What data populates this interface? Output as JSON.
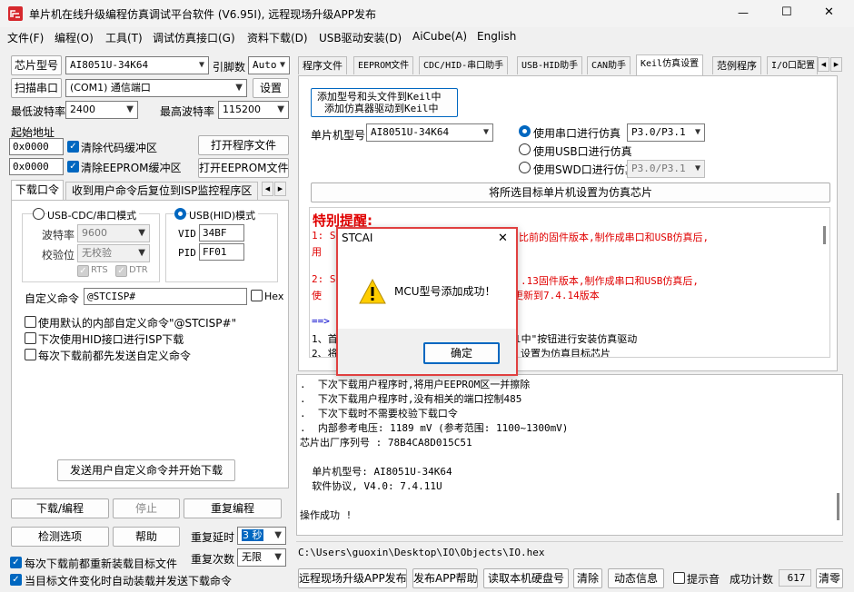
{
  "window": {
    "title": "单片机在线升级编程仿真调试平台软件 (V6.95I), 远程现场升级APP发布",
    "minimize": "—",
    "maximize": "☐",
    "close": "✕"
  },
  "menu": [
    "文件(F)",
    "编程(O)",
    "工具(T)",
    "调试仿真接口(G)",
    "资料下载(D)",
    "USB驱动安装(D)",
    "AiCube(A)",
    "English"
  ],
  "left": {
    "chip_btn": "芯片型号",
    "chip_value": "AI8051U-34K64",
    "pins_label": "引脚数",
    "pins_value": "Auto",
    "scan_btn": "扫描串口",
    "port_value": "(COM1) 通信端口",
    "settings_btn": "设置",
    "min_baud_label": "最低波特率",
    "min_baud": "2400",
    "max_baud_label": "最高波特率",
    "max_baud": "115200",
    "start_addr_label": "起始地址",
    "addr1": "0x0000",
    "clear_code": "清除代码缓冲区",
    "open_prog": "打开程序文件",
    "addr2": "0x0000",
    "clear_eeprom": "清除EEPROM缓冲区",
    "open_eeprom": "打开EEPROM文件",
    "tab_download": "下载口令",
    "tab_reset": "收到用户命令后复位到ISP监控程序区",
    "usb_cdc_mode": "USB-CDC/串口模式",
    "usb_hid_mode": "USB(HID)模式",
    "baud_label": "波特率",
    "baud_value": "9600",
    "parity_label": "校验位",
    "parity_value": "无校验",
    "rts": "RTS",
    "dtr": "DTR",
    "vid_label": "VID",
    "vid": "34BF",
    "pid_label": "PID",
    "pid": "FF01",
    "custom_cmd_label": "自定义命令",
    "custom_cmd": "@STCISP#",
    "hex": "Hex",
    "opt1": "使用默认的内部自定义命令\"@STCISP#\"",
    "opt2": "下次使用HID接口进行ISP下载",
    "opt3": "每次下载前都先发送自定义命令",
    "send_btn": "发送用户自定义命令并开始下载",
    "download_btn": "下载/编程",
    "stop_btn": "停止",
    "reprog_btn": "重复编程",
    "detect_btn": "检测选项",
    "help_btn": "帮助",
    "repeat_delay_label": "重复延时",
    "repeat_delay": "3 秒",
    "repeat_count_label": "重复次数",
    "repeat_count": "无限",
    "reload_each": "每次下载前都重新装载目标文件",
    "auto_load": "当目标文件变化时自动装载并发送下载命令"
  },
  "right": {
    "tabs": [
      "程序文件",
      "EEPROM文件",
      "CDC/HID-串口助手",
      "USB-HID助手",
      "CAN助手",
      "Keil仿真设置",
      "范例程序",
      "I/O口配置"
    ],
    "add_btn_line1": "添加型号和头文件到Keil中",
    "add_btn_line2": "添加仿真器驱动到Keil中",
    "mcu_label": "单片机型号",
    "mcu_value": "AI8051U-34K64",
    "serial_sim": "使用串口进行仿真",
    "serial_pins": "P3.0/P3.1",
    "usb_sim": "使用USB口进行仿真",
    "swd_sim": "使用SWD口进行仿真",
    "swd_pins": "P3.0/P3.1",
    "set_btn": "将所选目标单片机设置为仿真芯片",
    "notice_title": "特别提醒:",
    "notice_lines": [
      "1: S",
      "    用",
      "2: S",
      "    使",
      "   ==>",
      "1、首",
      "2、将"
    ],
    "notice_tails": [
      "比前的固件版本,制作成串口和USB仿真后,",
      "",
      ".13固件版本,制作成串口和USB仿真后,",
      "更新到7.4.14版本",
      "",
      "l中\"按钮进行安装仿真驱动",
      "设置为仿真目标芯片"
    ],
    "log": [
      ".  下次下载用户程序时,将用户EEPROM区一并擦除",
      ".  下次下载用户程序时,没有相关的端口控制485",
      ".  下次下载时不需要校验下载口令",
      ".  内部参考电压: 1189 mV (参考范围: 1100~1300mV)",
      "芯片出厂序列号 : 78B4CA8D015C51",
      "",
      "  单片机型号: AI8051U-34K64",
      "  软件协议, V4.0: 7.4.11U",
      "",
      "操作成功 !"
    ],
    "path": "C:\\Users\\guoxin\\Desktop\\IO\\Objects\\IO.hex",
    "publish_btn": "远程现场升级APP发布",
    "help_btn": "发布APP帮助",
    "read_disk_btn": "读取本机硬盘号",
    "clear_btn": "清除",
    "dynamic_btn": "动态信息",
    "beep": "提示音",
    "success_label": "成功计数",
    "success_count": "617",
    "reset_btn": "清零"
  },
  "dialog": {
    "title": "STCAI",
    "close": "✕",
    "message": "MCU型号添加成功！",
    "ok": "确定"
  }
}
